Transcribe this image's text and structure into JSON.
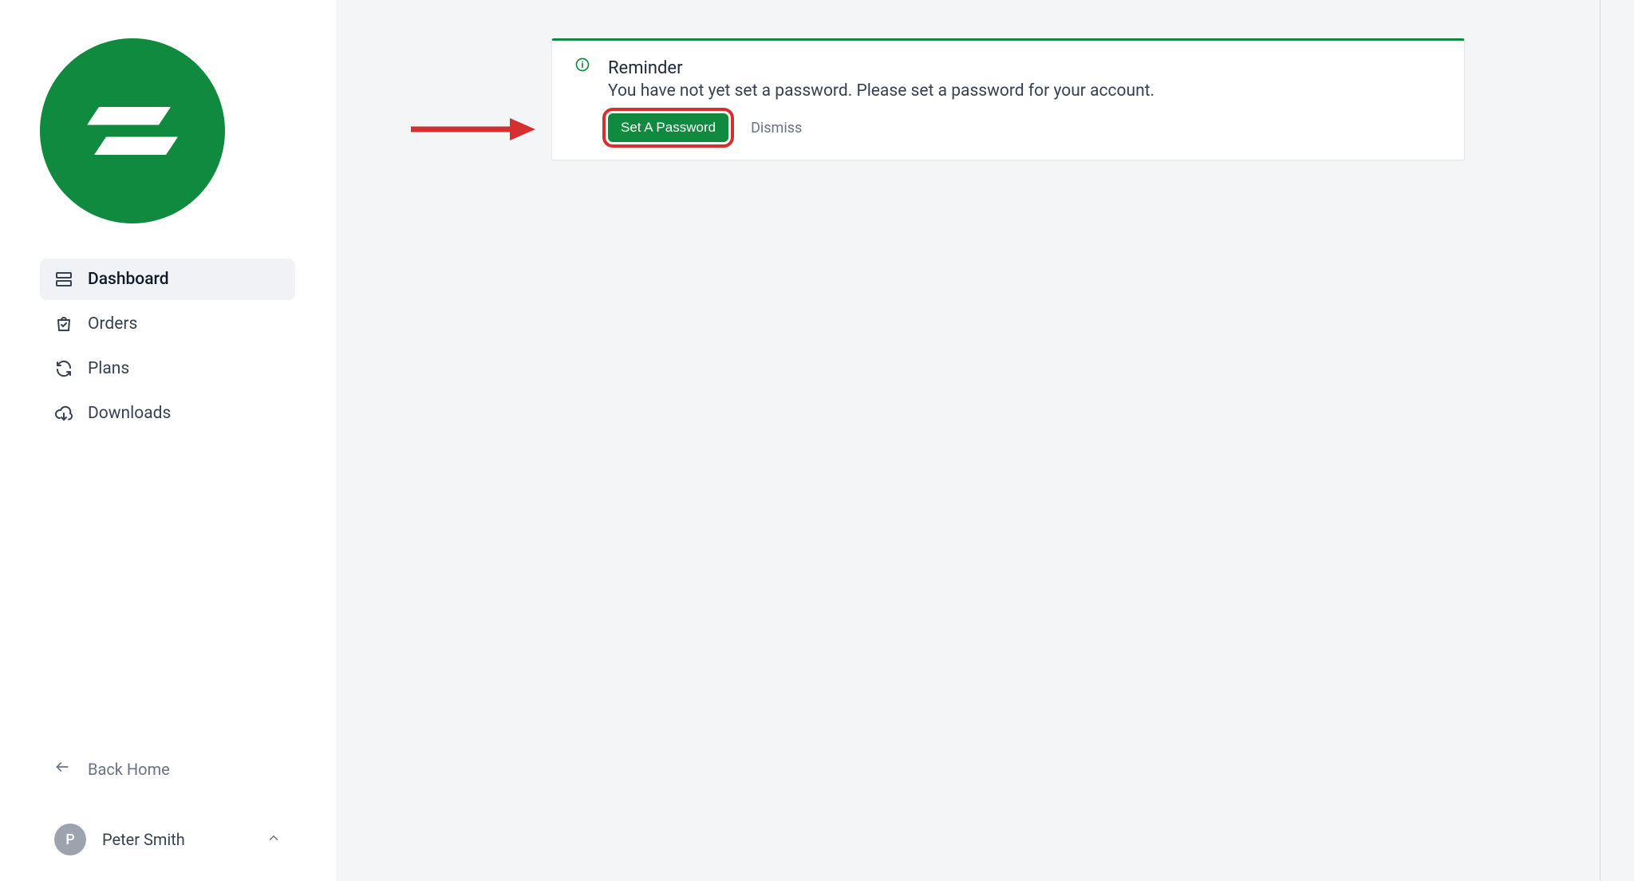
{
  "sidebar": {
    "items": [
      {
        "label": "Dashboard",
        "icon": "dashboard-icon",
        "active": true
      },
      {
        "label": "Orders",
        "icon": "bag-icon"
      },
      {
        "label": "Plans",
        "icon": "refresh-icon"
      },
      {
        "label": "Downloads",
        "icon": "cloud-download-icon"
      }
    ],
    "back_home_label": "Back Home"
  },
  "user": {
    "name": "Peter Smith",
    "initial": "P"
  },
  "notice": {
    "title": "Reminder",
    "message": "You have not yet set a password. Please set a password for your account.",
    "primary_button_label": "Set A Password",
    "dismiss_label": "Dismiss"
  },
  "colors": {
    "brand_green": "#0f8a3f",
    "bg_main": "#f4f5f7",
    "text": "#1f2937",
    "annotation_red": "#d62f2f"
  },
  "annotations": {
    "highlight_primary_button": true,
    "arrow_to_primary_button": true
  }
}
